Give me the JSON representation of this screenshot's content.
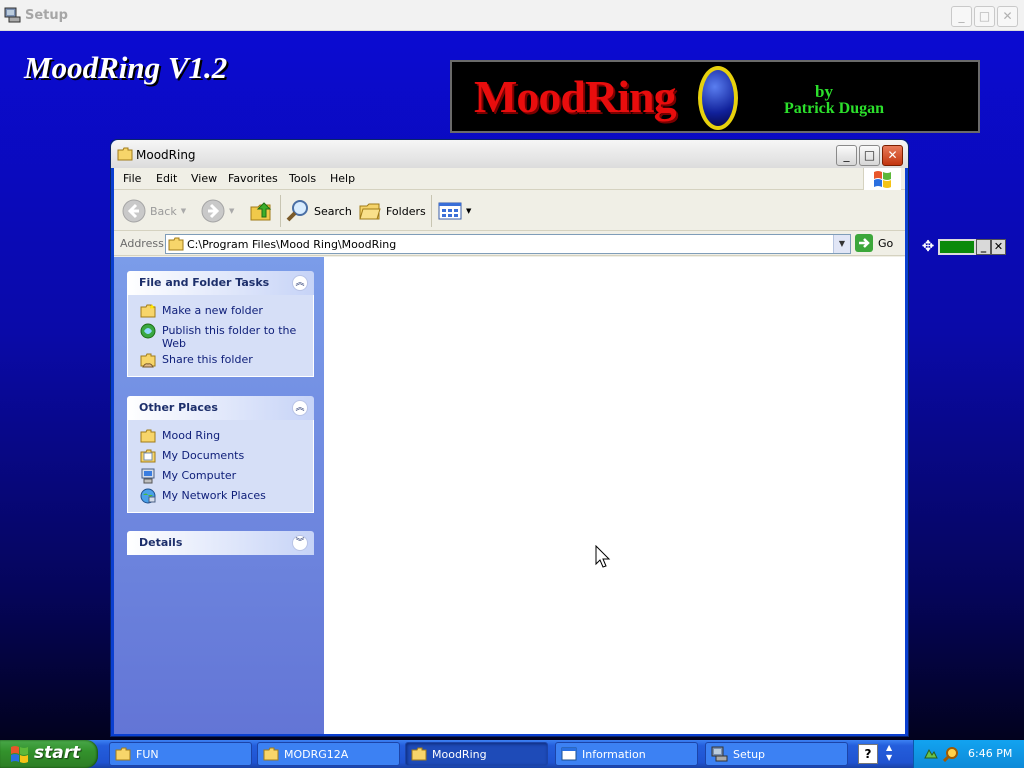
{
  "setup": {
    "title": "Setup",
    "app_title": "MoodRing V1.2"
  },
  "banner": {
    "logo_text": "MoodRing",
    "by": "by",
    "author": "Patrick Dugan"
  },
  "explorer": {
    "title": "MoodRing",
    "menu": [
      "File",
      "Edit",
      "View",
      "Favorites",
      "Tools",
      "Help"
    ],
    "toolbar": {
      "back": "Back",
      "search": "Search",
      "folders": "Folders"
    },
    "address": {
      "label": "Address",
      "value": "C:\\Program Files\\Mood Ring\\MoodRing",
      "go": "Go"
    },
    "tasks": {
      "header": "File and Folder Tasks",
      "items": [
        "Make a new folder",
        "Publish this folder to the Web",
        "Share this folder"
      ]
    },
    "other_places": {
      "header": "Other Places",
      "items": [
        "Mood Ring",
        "My Documents",
        "My Computer",
        "My Network Places"
      ]
    },
    "details": {
      "header": "Details"
    }
  },
  "taskbar": {
    "start": "start",
    "buttons": [
      "FUN",
      "MODRG12A",
      "MoodRing",
      "Information",
      "Setup"
    ],
    "active": "MoodRing",
    "clock": "6:46 PM"
  },
  "colors": {
    "taskbar": "#245edc",
    "start": "#33922c",
    "accent": "#0a3fd0"
  }
}
